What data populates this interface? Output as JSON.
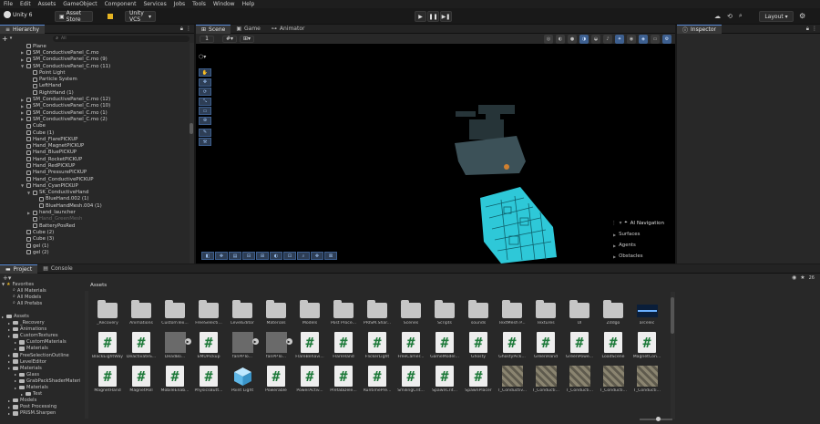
{
  "menubar": {
    "logo": "Unity 6",
    "items": [
      "File",
      "Edit",
      "Assets",
      "GameObject",
      "Component",
      "Services",
      "Jobs",
      "Tools",
      "Window",
      "Help"
    ]
  },
  "toolbar": {
    "asset_store": "Asset Store",
    "vcs": "Unity VCS",
    "layout": "Layout"
  },
  "hierarchy": {
    "tab": "Hierarchy",
    "add": "+",
    "search_placeholder": "All",
    "items": [
      {
        "label": "Plane",
        "depth": 0,
        "exp": ""
      },
      {
        "label": "SM_ConductivePanel_C.mo",
        "depth": 0,
        "exp": "▶"
      },
      {
        "label": "SM_ConductivePanel_C.mo (9)",
        "depth": 0,
        "exp": "▶"
      },
      {
        "label": "SM_ConductivePanel_C.mo (11)",
        "depth": 0,
        "exp": "▼"
      },
      {
        "label": "Point Light",
        "depth": 1,
        "exp": ""
      },
      {
        "label": "Particle System",
        "depth": 1,
        "exp": ""
      },
      {
        "label": "LeftHand",
        "depth": 1,
        "exp": ""
      },
      {
        "label": "RightHand (1)",
        "depth": 1,
        "exp": ""
      },
      {
        "label": "SM_ConductivePanel_C.mo (12)",
        "depth": 0,
        "exp": "▶"
      },
      {
        "label": "SM_ConductivePanel_C.mo (10)",
        "depth": 0,
        "exp": "▶"
      },
      {
        "label": "SM_ConductivePanel_C.mo (1)",
        "depth": 0,
        "exp": "▶"
      },
      {
        "label": "SM_ConductivePanel_C.mo (2)",
        "depth": 0,
        "exp": "▶"
      },
      {
        "label": "Cube",
        "depth": 0,
        "exp": ""
      },
      {
        "label": "Cube (1)",
        "depth": 0,
        "exp": ""
      },
      {
        "label": "Hand_FlarePICKUP",
        "depth": 0,
        "exp": ""
      },
      {
        "label": "Hand_MagnetPICKUP",
        "depth": 0,
        "exp": ""
      },
      {
        "label": "Hand_BluePICKUP",
        "depth": 0,
        "exp": ""
      },
      {
        "label": "Hand_RocketPICKUP",
        "depth": 0,
        "exp": ""
      },
      {
        "label": "Hand_RedPICKUP",
        "depth": 0,
        "exp": ""
      },
      {
        "label": "Hand_PressurePICKUP",
        "depth": 0,
        "exp": ""
      },
      {
        "label": "Hand_ConductivePICKUP",
        "depth": 0,
        "exp": ""
      },
      {
        "label": "Hand_CyanPICKUP",
        "depth": 0,
        "exp": "▼"
      },
      {
        "label": "SK_ConductiveHand",
        "depth": 1,
        "exp": "▼"
      },
      {
        "label": "BlueHand.002 (1)",
        "depth": 2,
        "exp": ""
      },
      {
        "label": "BlueHandMesh.004 (1)",
        "depth": 2,
        "exp": ""
      },
      {
        "label": "hand_launcher",
        "depth": 1,
        "exp": "▶"
      },
      {
        "label": "Hand_GreenMesh",
        "depth": 1,
        "exp": ""
      },
      {
        "label": "BatteryPosRed",
        "depth": 1,
        "exp": ""
      },
      {
        "label": "Cube (2)",
        "depth": 0,
        "exp": ""
      },
      {
        "label": "Cube (3)",
        "depth": 0,
        "exp": ""
      },
      {
        "label": "gel (1)",
        "depth": 0,
        "exp": ""
      },
      {
        "label": "gel (2)",
        "depth": 0,
        "exp": ""
      }
    ]
  },
  "scene": {
    "tabs": [
      "Scene",
      "Game",
      "Animator"
    ],
    "overlay_title": "AI Navigation",
    "overlay_items": [
      "Surfaces",
      "Agents",
      "Obstacles"
    ]
  },
  "inspector": {
    "tab": "Inspector"
  },
  "project": {
    "tabs": [
      "Project",
      "Console"
    ],
    "breadcrumb": "Assets",
    "zoom_badge": "26",
    "tree_favorites": "Favorites",
    "tree": [
      {
        "label": "All Materials",
        "depth": 1
      },
      {
        "label": "All Models",
        "depth": 1
      },
      {
        "label": "All Prefabs",
        "depth": 1
      },
      {
        "label": "",
        "depth": 0
      },
      {
        "label": "Assets",
        "depth": 0
      },
      {
        "label": "_Recovery",
        "depth": 1
      },
      {
        "label": "Animations",
        "depth": 1
      },
      {
        "label": "CustomTextures",
        "depth": 1
      },
      {
        "label": "CustomMaterials",
        "depth": 2
      },
      {
        "label": "Materials",
        "depth": 2
      },
      {
        "label": "FreeSelectionOutline",
        "depth": 1
      },
      {
        "label": "LevelEditor",
        "depth": 1
      },
      {
        "label": "Materials",
        "depth": 1
      },
      {
        "label": "Glass",
        "depth": 2
      },
      {
        "label": "GrabPackShaderMateri",
        "depth": 2
      },
      {
        "label": "Materials",
        "depth": 2
      },
      {
        "label": "Test",
        "depth": 3
      },
      {
        "label": "Models",
        "depth": 1
      },
      {
        "label": "Post Processing",
        "depth": 1
      },
      {
        "label": "PRISM.Sharpen",
        "depth": 1
      }
    ],
    "assets_row1": [
      {
        "label": "_Recovery",
        "kind": "folder"
      },
      {
        "label": "Animations",
        "kind": "folder"
      },
      {
        "label": "CustomTex...",
        "kind": "folder"
      },
      {
        "label": "FreeSelecti...",
        "kind": "folder"
      },
      {
        "label": "LevelEditor",
        "kind": "folder"
      },
      {
        "label": "Materials",
        "kind": "folder"
      },
      {
        "label": "Models",
        "kind": "folder"
      },
      {
        "label": "Post Proce...",
        "kind": "folder"
      },
      {
        "label": "PRISM.Shar...",
        "kind": "folder"
      },
      {
        "label": "Scenes",
        "kind": "folder"
      },
      {
        "label": "Scripts",
        "kind": "folder"
      },
      {
        "label": "sounds",
        "kind": "folder"
      },
      {
        "label": "TextMesh P...",
        "kind": "folder"
      },
      {
        "label": "Textures",
        "kind": "folder"
      },
      {
        "label": "UI",
        "kind": "folder"
      },
      {
        "label": "Zddgo",
        "kind": "folder"
      },
      {
        "label": "arcelec",
        "kind": "image"
      }
    ],
    "assets_row2": [
      {
        "label": "BlackEightWay",
        "kind": "script"
      },
      {
        "label": "DeactivateS...",
        "kind": "script"
      },
      {
        "label": "DeadBo...",
        "kind": "prefab"
      },
      {
        "label": "EMUPickup",
        "kind": "script"
      },
      {
        "label": "fanPPTo...",
        "kind": "prefab"
      },
      {
        "label": "fanPPTo...",
        "kind": "prefab"
      },
      {
        "label": "FlareBehavi...",
        "kind": "script"
      },
      {
        "label": "FlareHand",
        "kind": "script"
      },
      {
        "label": "FlickerLight",
        "kind": "script"
      },
      {
        "label": "FreeCamer...",
        "kind": "script"
      },
      {
        "label": "GameModel...",
        "kind": "script"
      },
      {
        "label": "Ghosty",
        "kind": "script"
      },
      {
        "label": "GhostyPick...",
        "kind": "script"
      },
      {
        "label": "GreenHand",
        "kind": "script"
      },
      {
        "label": "GreenPowe...",
        "kind": "script"
      },
      {
        "label": "LoadScene",
        "kind": "script"
      },
      {
        "label": "MagnetCon...",
        "kind": "script"
      }
    ],
    "assets_row3": [
      {
        "label": "MagnetHand",
        "kind": "script"
      },
      {
        "label": "MagnetPoll",
        "kind": "script"
      },
      {
        "label": "MobileEnab...",
        "kind": "script"
      },
      {
        "label": "PhysicsButt...",
        "kind": "script"
      },
      {
        "label": "Point Light",
        "kind": "cube"
      },
      {
        "label": "Powerable",
        "kind": "script"
      },
      {
        "label": "PowerActiv...",
        "kind": "script"
      },
      {
        "label": "PrefabDele...",
        "kind": "script"
      },
      {
        "label": "RuntimePre...",
        "kind": "script"
      },
      {
        "label": "SmilingCrit...",
        "kind": "script"
      },
      {
        "label": "SpawnCrit...",
        "kind": "script"
      },
      {
        "label": "SpawnPlacer",
        "kind": "script"
      },
      {
        "label": "T_Conductiv...",
        "kind": "texture"
      },
      {
        "label": "T_Conducti...",
        "kind": "texture"
      },
      {
        "label": "T_Conducti...",
        "kind": "texture"
      },
      {
        "label": "T_Conducti...",
        "kind": "texture"
      },
      {
        "label": "T_Conducti...",
        "kind": "texture"
      }
    ]
  },
  "colors": {
    "accent": "#5a8bd6",
    "cyan_mesh": "#2ec8d8",
    "script_green": "#1e7a3a"
  }
}
